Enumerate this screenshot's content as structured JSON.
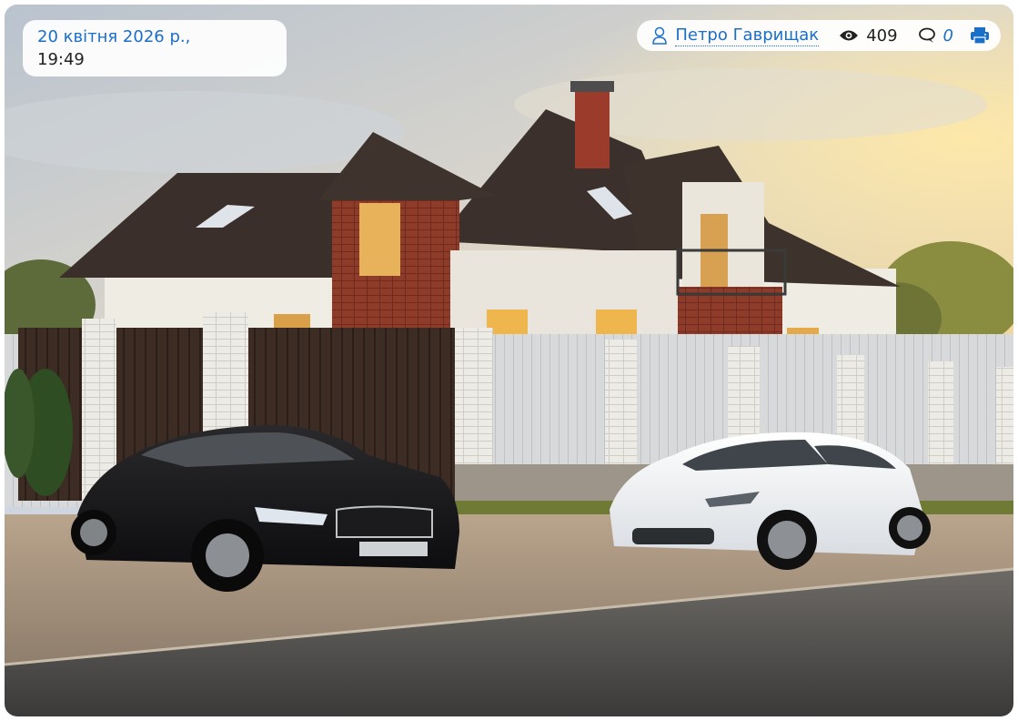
{
  "article": {
    "date": "20 квітня 2026 р.,",
    "time": "19:49",
    "author": "Петро Гаврищак",
    "views": "409",
    "comments": "0"
  },
  "icons": {
    "author": "user-outline-icon",
    "views": "eye-icon",
    "comments": "comment-icon",
    "print": "print-icon"
  },
  "colors": {
    "link": "#1a6fc9",
    "text": "#222222",
    "pill_bg": "#ffffff"
  }
}
